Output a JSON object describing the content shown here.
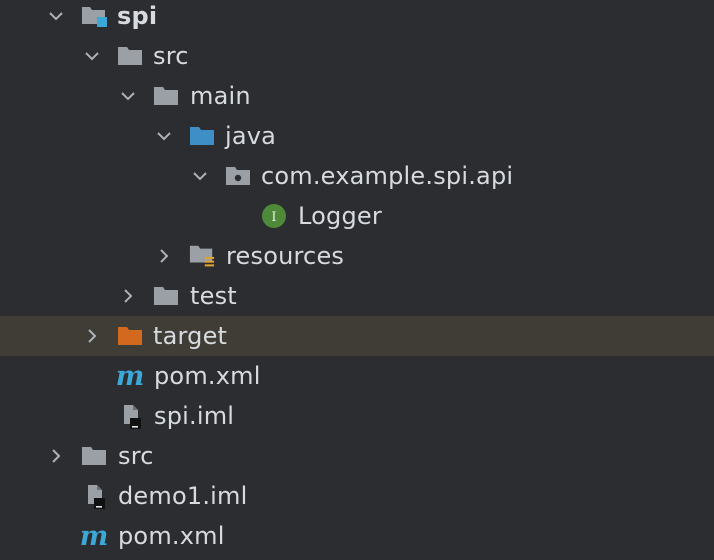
{
  "colors": {
    "background": "#2b2d30",
    "selected_row": "#3f3d36",
    "text": "#d7dadf",
    "folder_gray": "#9aa0a6",
    "source_folder_blue": "#3d8fc6",
    "excluded_folder_orange": "#d2691e",
    "interface_green": "#4f8a3a",
    "maven_blue": "#3ba8d8"
  },
  "tree": {
    "items": [
      {
        "label": "spi",
        "icon": "module-folder-icon",
        "chevron": "expanded",
        "bold": true
      },
      {
        "label": "src",
        "icon": "folder-icon",
        "chevron": "expanded"
      },
      {
        "label": "main",
        "icon": "folder-icon",
        "chevron": "expanded"
      },
      {
        "label": "java",
        "icon": "source-root-folder-icon",
        "chevron": "expanded"
      },
      {
        "label": "com.example.spi.api",
        "icon": "package-icon",
        "chevron": "expanded"
      },
      {
        "label": "Logger",
        "icon": "interface-icon",
        "icon_glyph": "I",
        "chevron": "none"
      },
      {
        "label": "resources",
        "icon": "resources-folder-icon",
        "chevron": "collapsed"
      },
      {
        "label": "test",
        "icon": "folder-icon",
        "chevron": "collapsed"
      },
      {
        "label": "target",
        "icon": "excluded-folder-icon",
        "chevron": "collapsed",
        "selected": true
      },
      {
        "label": "pom.xml",
        "icon": "maven-icon",
        "icon_glyph": "m",
        "chevron": "none"
      },
      {
        "label": "spi.iml",
        "icon": "iml-file-icon",
        "chevron": "none"
      },
      {
        "label": "src",
        "icon": "folder-icon",
        "chevron": "collapsed"
      },
      {
        "label": "demo1.iml",
        "icon": "iml-file-icon",
        "chevron": "none"
      },
      {
        "label": "pom.xml",
        "icon": "maven-icon",
        "icon_glyph": "m",
        "chevron": "none"
      }
    ]
  }
}
